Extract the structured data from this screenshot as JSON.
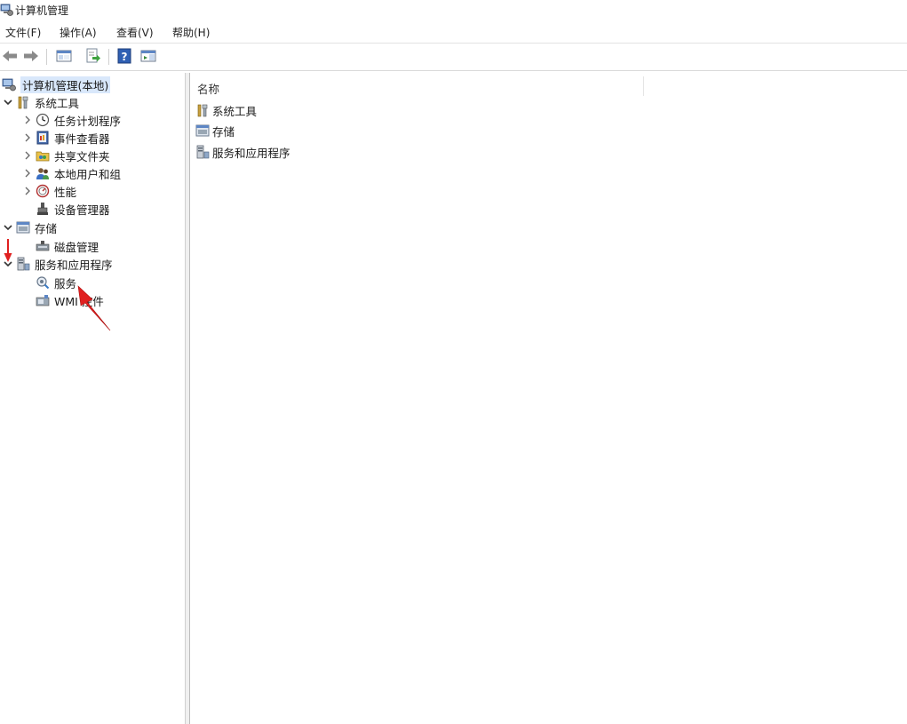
{
  "window": {
    "title": "计算机管理"
  },
  "menu": [
    {
      "label": "文件(F)"
    },
    {
      "label": "操作(A)"
    },
    {
      "label": "查看(V)"
    },
    {
      "label": "帮助(H)"
    }
  ],
  "toolbar": [
    {
      "icon": "back-arrow-icon"
    },
    {
      "icon": "forward-arrow-icon"
    },
    {
      "icon": "show-hide-console-tree-icon"
    },
    {
      "icon": "export-list-icon"
    },
    {
      "icon": "help-icon"
    },
    {
      "icon": "action-pane-icon"
    }
  ],
  "tree": {
    "root": "计算机管理(本地)",
    "system_tools": "系统工具",
    "task_scheduler": "任务计划程序",
    "event_viewer": "事件查看器",
    "shared_folders": "共享文件夹",
    "local_users_groups": "本地用户和组",
    "performance": "性能",
    "device_manager": "设备管理器",
    "storage": "存储",
    "disk_management": "磁盘管理",
    "services_apps": "服务和应用程序",
    "services": "服务",
    "wmi_control": "WMI 控件"
  },
  "list": {
    "column_name": "名称",
    "items": [
      {
        "label": "系统工具",
        "icon": "tools-icon"
      },
      {
        "label": "存储",
        "icon": "storage-icon"
      },
      {
        "label": "服务和应用程序",
        "icon": "services-apps-icon"
      }
    ]
  },
  "colors": {
    "selection": "#d9e8fb",
    "annotation_arrow": "#e02020",
    "separator": "#cfcfcf"
  }
}
